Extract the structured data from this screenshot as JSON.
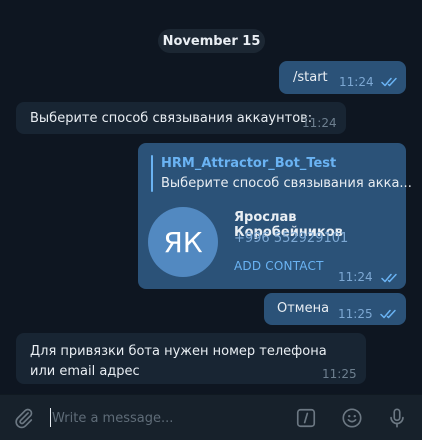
{
  "chat": {
    "date_separator": "November 15",
    "messages": [
      {
        "id": "start",
        "direction": "out",
        "text": "/start",
        "time": "11:24",
        "read": true
      },
      {
        "id": "choose",
        "direction": "in",
        "text": "Выберите способ связывания аккаунтов:",
        "time": "11:24"
      },
      {
        "id": "contact",
        "direction": "out",
        "time": "11:24",
        "read": true,
        "reply": {
          "name": "HRM_Attractor_Bot_Test",
          "text": "Выберите способ связывания акка..."
        },
        "contact": {
          "initials": "ЯК",
          "name": "Ярослав Коробейников",
          "phone": "+996 552929101",
          "action": "ADD CONTACT"
        }
      },
      {
        "id": "cancel",
        "direction": "out",
        "text": "Отмена",
        "time": "11:25",
        "read": true
      },
      {
        "id": "phone",
        "direction": "in",
        "text": "Для привязки бота нужен номер телефона или email адрес",
        "time": "11:25"
      }
    ]
  },
  "composer": {
    "placeholder": "Write a message...",
    "value": "",
    "icons": [
      "paperclip-icon",
      "bot-command-icon",
      "emoji-icon",
      "microphone-icon"
    ]
  },
  "colors": {
    "background": "#0e1621",
    "incoming_bubble": "#182533",
    "outgoing_bubble": "#2b5278",
    "accent": "#6ab3f3",
    "avatar": "#5289c1"
  }
}
